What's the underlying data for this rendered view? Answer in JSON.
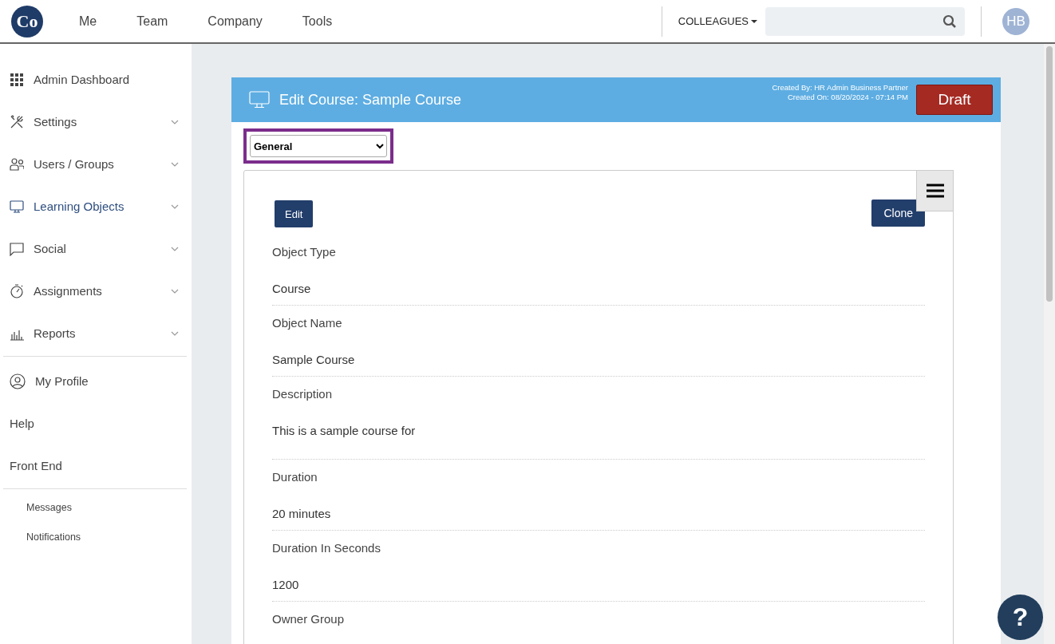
{
  "topnav": {
    "logo": "Co",
    "links": [
      "Me",
      "Team",
      "Company",
      "Tools"
    ],
    "colleagues": "COLLEAGUES",
    "avatar": "HB"
  },
  "sidebar": {
    "sections": [
      {
        "items": [
          {
            "label": "Admin Dashboard",
            "expandable": false,
            "selected": false
          },
          {
            "label": "Settings",
            "expandable": true,
            "selected": false
          },
          {
            "label": "Users / Groups",
            "expandable": true,
            "selected": false
          },
          {
            "label": "Learning Objects",
            "expandable": true,
            "selected": true
          },
          {
            "label": "Social",
            "expandable": true,
            "selected": false
          },
          {
            "label": "Assignments",
            "expandable": true,
            "selected": false
          },
          {
            "label": "Reports",
            "expandable": true,
            "selected": false
          }
        ]
      },
      {
        "items": [
          {
            "label": "My Profile",
            "expandable": false,
            "selected": false
          },
          {
            "label": "Help",
            "expandable": false,
            "selected": false
          },
          {
            "label": "Front End",
            "expandable": false,
            "selected": false
          }
        ]
      },
      {
        "small": true,
        "items": [
          {
            "label": "Messages",
            "expandable": false,
            "selected": false
          },
          {
            "label": "Notifications",
            "expandable": false,
            "selected": false
          }
        ]
      }
    ]
  },
  "card": {
    "title": "Edit Course: Sample Course",
    "created_by": "Created By: HR Admin Business Partner",
    "created_on": "Created On: 08/20/2024 - 07:14 PM",
    "status": "Draft",
    "section_select": "General",
    "buttons": [
      "Edit",
      "Clone"
    ],
    "fields": [
      {
        "label": "Object Type",
        "value": "Course"
      },
      {
        "label": "Object Name",
        "value": "Sample Course"
      },
      {
        "label": "Description",
        "value": "This is a sample course for",
        "tall": true
      },
      {
        "label": "Duration",
        "value": "20 minutes"
      },
      {
        "label": "Duration In Seconds",
        "value": "1200"
      },
      {
        "label": "Owner Group"
      }
    ]
  },
  "help_button": "?"
}
